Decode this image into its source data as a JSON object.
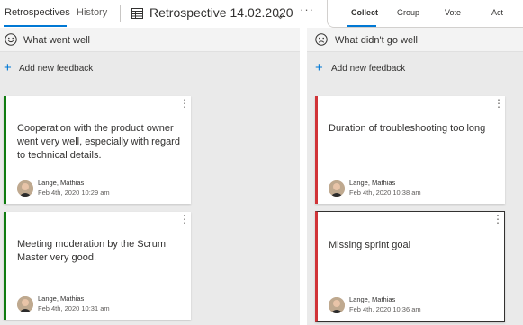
{
  "nav": {
    "tabs": [
      "Retrospectives",
      "History"
    ],
    "board_title": "Retrospective 14.02.2020",
    "more": "···"
  },
  "phases": [
    "Collect",
    "Group",
    "Vote",
    "Act"
  ],
  "columns": [
    {
      "title": "What went well",
      "icon": "smile-icon",
      "accent": "#107c10",
      "add_label": "Add new feedback",
      "cards": [
        {
          "text": "Cooperation with the product owner went very well, especially with regard to technical details.",
          "author": "Lange, Mathias",
          "date": "Feb 4th, 2020 10:29 am"
        },
        {
          "text": "Meeting moderation by the Scrum Master very good.",
          "author": "Lange, Mathias",
          "date": "Feb 4th, 2020 10:31 am"
        }
      ]
    },
    {
      "title": "What didn't go well",
      "icon": "frown-icon",
      "accent": "#d13438",
      "add_label": "Add new feedback",
      "cards": [
        {
          "text": "Duration of troubleshooting too long",
          "author": "Lange, Mathias",
          "date": "Feb 4th, 2020 10:38 am"
        },
        {
          "text": "Missing sprint goal",
          "author": "Lange, Mathias",
          "date": "Feb 4th, 2020 10:36 am"
        }
      ]
    }
  ],
  "colors": {
    "accent": "#0078d4",
    "column_bg": "#eaeaea"
  }
}
